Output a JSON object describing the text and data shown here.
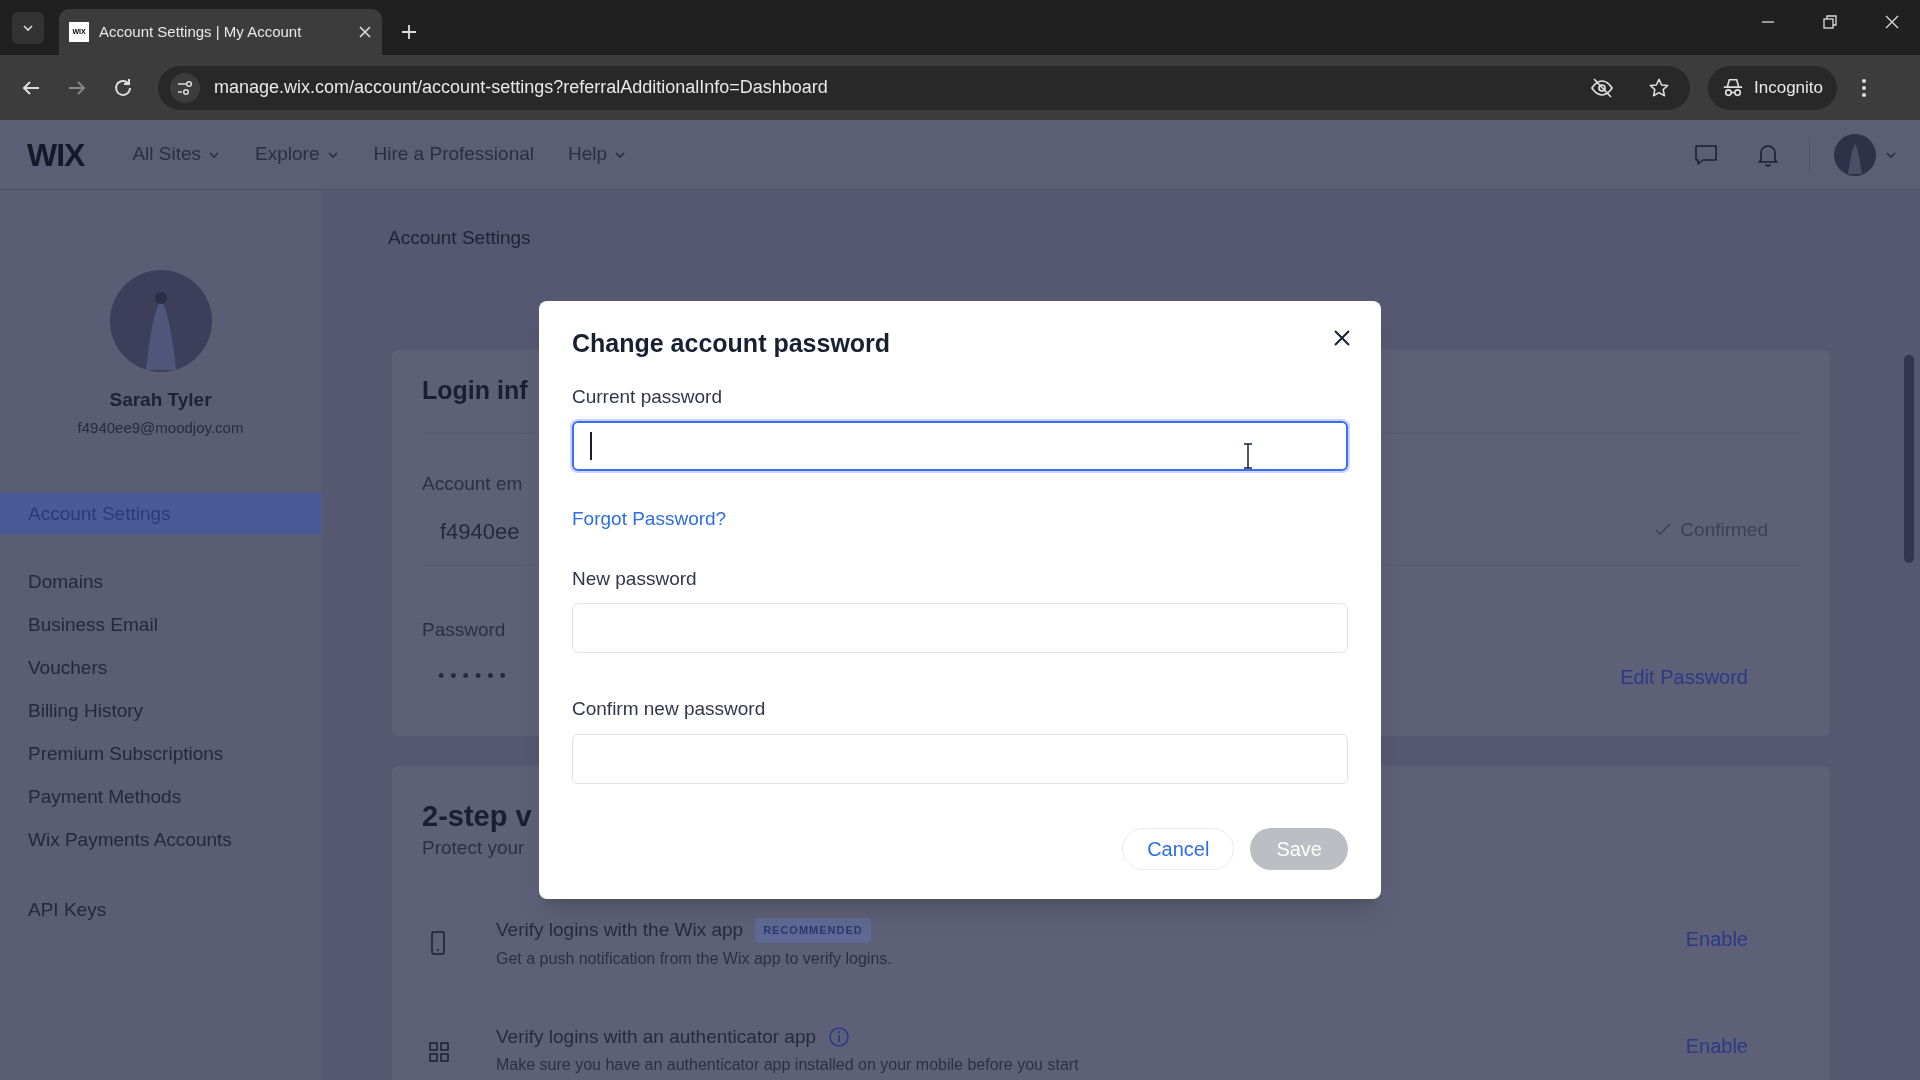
{
  "browser": {
    "tabs": [
      {
        "favicon": "WIX",
        "title": "Account Settings | My Account",
        "selected": true
      }
    ],
    "url": "manage.wix.com/account/account-settings?referralAdditionalInfo=Dashboard",
    "profile": "Incognito"
  },
  "header": {
    "logo": "WIX",
    "nav": [
      {
        "label": "All Sites",
        "dropdown": true
      },
      {
        "label": "Explore",
        "dropdown": true
      },
      {
        "label": "Hire a Professional",
        "dropdown": false
      },
      {
        "label": "Help",
        "dropdown": true
      }
    ]
  },
  "sidebar": {
    "user": {
      "name": "Sarah Tyler",
      "email": "f4940ee9@moodjoy.com"
    },
    "groups": [
      {
        "items": [
          {
            "label": "Account Settings",
            "selected": true
          }
        ]
      },
      {
        "items": [
          {
            "label": "Domains",
            "selected": false
          },
          {
            "label": "Business Email",
            "selected": false
          },
          {
            "label": "Vouchers",
            "selected": false
          },
          {
            "label": "Billing History",
            "selected": false
          },
          {
            "label": "Premium Subscriptions",
            "selected": false
          },
          {
            "label": "Payment Methods",
            "selected": false
          },
          {
            "label": "Wix Payments Accounts",
            "selected": false
          }
        ]
      },
      {
        "items": [
          {
            "label": "API Keys",
            "selected": false
          }
        ]
      }
    ]
  },
  "page": {
    "title": "Account Settings",
    "login_card": {
      "title": "Login inf",
      "email_label": "Account em",
      "email_value": "f4940ee",
      "email_status": "Confirmed",
      "password_label": "Password",
      "password_value": "••••••",
      "edit_link": "Edit Password"
    },
    "two_step": {
      "title": "2-step v",
      "subtitle": "Protect your",
      "methods": [
        {
          "kind": "phone",
          "title": "Verify logins with the Wix app",
          "badge": "RECOMMENDED",
          "info": false,
          "description": "Get a push notification from the Wix app to verify logins.",
          "action": "Enable"
        },
        {
          "kind": "qr",
          "title": "Verify logins with an authenticator app",
          "info": true,
          "description": "Make sure you have an authenticator app installed on your mobile before you start",
          "action": "Enable"
        }
      ]
    }
  },
  "modal": {
    "title": "Change account password",
    "fields": [
      {
        "label": "Current password",
        "focused": true
      },
      {
        "label": "New password",
        "focused": false
      },
      {
        "label": "Confirm new password",
        "focused": false
      }
    ],
    "forgot_link": "Forgot Password?",
    "cancel": "Cancel",
    "save": {
      "label": "Save",
      "disabled": true
    }
  }
}
